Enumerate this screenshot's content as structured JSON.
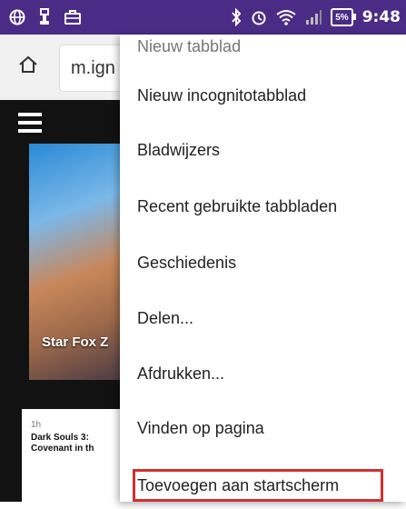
{
  "status_bar": {
    "time": "9:48",
    "battery": "5%",
    "icons": [
      "globe-icon",
      "usb-icon",
      "briefcase-icon",
      "bluetooth-icon",
      "alarm-icon",
      "wifi-icon",
      "signal-icon",
      "battery-icon"
    ]
  },
  "address_bar": {
    "url": "m.ign"
  },
  "page": {
    "hero_label": "Star Fox Z",
    "article": {
      "age": "1h",
      "title": "Dark Souls 3: Covenant in th"
    }
  },
  "menu": {
    "items": [
      {
        "label": "Nieuw tabblad"
      },
      {
        "label": "Nieuw incognitotabblad"
      },
      {
        "label": "Bladwijzers"
      },
      {
        "label": "Recent gebruikte tabbladen"
      },
      {
        "label": "Geschiedenis"
      },
      {
        "label": "Delen..."
      },
      {
        "label": "Afdrukken..."
      },
      {
        "label": "Vinden op pagina"
      },
      {
        "label": "Toevoegen aan startscherm"
      }
    ]
  },
  "colors": {
    "status_bar": "#4a2c86",
    "highlight": "#d32f2f"
  }
}
